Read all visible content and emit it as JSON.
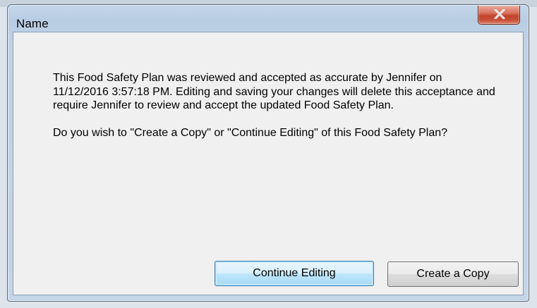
{
  "window": {
    "title": "Name"
  },
  "message": {
    "paragraph1": "This Food Safety Plan was reviewed and accepted as accurate by Jennifer on 11/12/2016 3:57:18 PM. Editing and saving your changes will delete this acceptance and require Jennifer to review and accept the updated Food Safety Plan.",
    "paragraph2": "Do you wish to \"Create a Copy\" or \"Continue Editing\" of this Food Safety Plan?"
  },
  "buttons": {
    "continue_label": "Continue Editing",
    "copy_label": "Create a Copy"
  },
  "icons": {
    "close": "close-icon"
  },
  "colors": {
    "close_button": "#c8513a",
    "default_button_border": "#3c7fb1",
    "client_background": "#f0f0f0"
  }
}
